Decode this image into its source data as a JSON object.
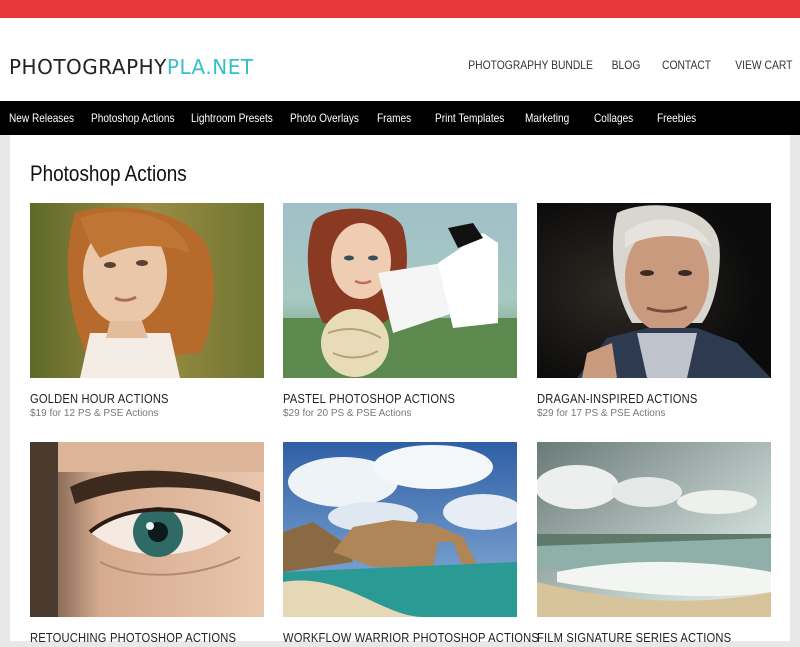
{
  "logo": {
    "part1": "PHOTOGRAPHY",
    "part2": "PLA.NET"
  },
  "top_links": [
    "PHOTOGRAPHY BUNDLE",
    "BLOG",
    "CONTACT",
    "VIEW CART"
  ],
  "nav": [
    "New Releases",
    "Photoshop Actions",
    "Lightroom Presets",
    "Photo Overlays",
    "Frames",
    "Print Templates",
    "Marketing",
    "Collages",
    "Freebies"
  ],
  "page_title": "Photoshop Actions",
  "products": [
    {
      "title": "GOLDEN HOUR ACTIONS",
      "subtitle": "$19 for 12 PS & PSE Actions"
    },
    {
      "title": "PASTEL PHOTOSHOP ACTIONS",
      "subtitle": "$29 for 20 PS & PSE Actions"
    },
    {
      "title": "DRAGAN-INSPIRED ACTIONS",
      "subtitle": "$29 for 17 PS & PSE Actions"
    },
    {
      "title": "RETOUCHING PHOTOSHOP ACTIONS",
      "subtitle": ""
    },
    {
      "title": "WORKFLOW WARRIOR PHOTOSHOP ACTIONS",
      "subtitle": ""
    },
    {
      "title": "FILM SIGNATURE SERIES ACTIONS",
      "subtitle": ""
    }
  ],
  "colors": {
    "accent_red": "#e8383d",
    "logo_teal": "#36bfc8",
    "nav_bg": "#000000"
  }
}
